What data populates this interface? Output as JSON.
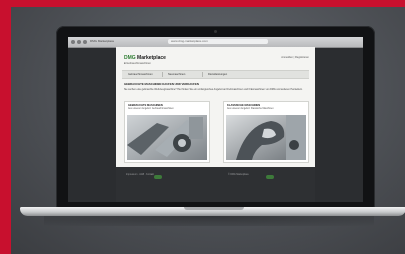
{
  "browser": {
    "title": "DMG Marketplace",
    "url": "www.dmg-marketplace.com"
  },
  "site": {
    "logo_brand": "DMG",
    "logo_rest": " Marketplace",
    "logo_sub": "■ Gebrauchtmaschinen",
    "login": "Anmelden | Registrieren",
    "nav": [
      "Gebrauchtmaschinen",
      "Neumaschinen",
      "Dienstleistungen"
    ],
    "intro_title": "GEBRAUCHTE MASCHINEN KAUFEN UND VERKAUFEN",
    "intro_text": "Sie suchen eine gebrauchte Werkzeugmaschine? Hier finden Sie ein umfangreiches Angebot an Drehmaschinen und Fräsmaschinen von DMG und anderen Herstellern.",
    "cards": [
      {
        "title": "GEBRAUCHTE MASCHINEN",
        "text": "Aus unserem Angebot: Gebrauchtmaschinen"
      },
      {
        "title": "KLASSISCHE MASCHINEN",
        "text": "Aus unserem Angebot: Klassische Maschinen"
      }
    ],
    "footer": [
      "Impressum · AGB · Kontakt",
      "© DMG Marketplace"
    ]
  },
  "colors": {
    "accent_red": "#c8102e",
    "brand_green": "#2e7d32"
  }
}
